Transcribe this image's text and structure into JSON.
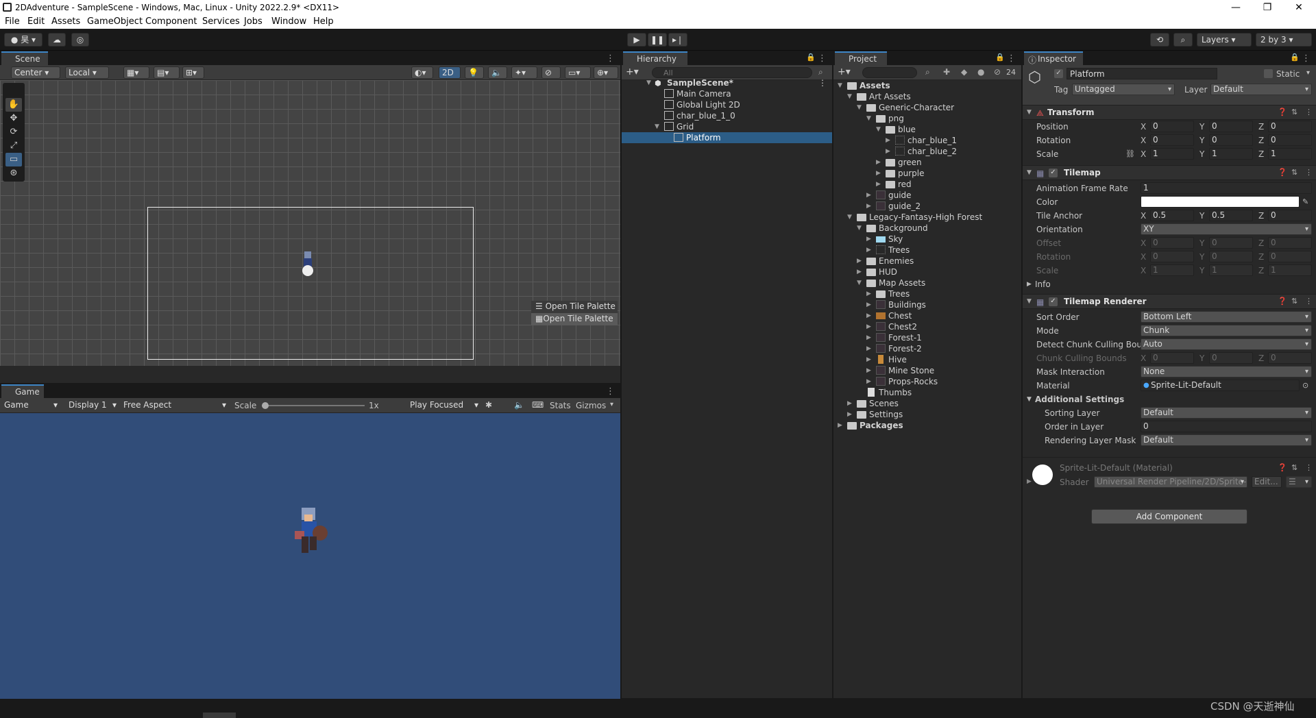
{
  "window": {
    "title": "2DAdventure - SampleScene - Windows, Mac, Linux - Unity 2022.2.9* <DX11>",
    "minimize": "—",
    "maximize": "❐",
    "close": "✕"
  },
  "menu": [
    "File",
    "Edit",
    "Assets",
    "GameObject",
    "Component",
    "Services",
    "Jobs",
    "Window",
    "Help"
  ],
  "toolbar": {
    "account": "昊",
    "layers_label": "Layers",
    "layout_label": "2 by 3"
  },
  "scene": {
    "tab": "Scene",
    "pivot": "Center",
    "space": "Local",
    "mode_2d": "2D",
    "open_tile_palette_1": "Open Tile Palette",
    "open_tile_palette_2": "Open Tile Palette"
  },
  "game": {
    "tab": "Game",
    "mode": "Game",
    "display": "Display 1",
    "aspect": "Free Aspect",
    "scale_label": "Scale",
    "scale_value": "1x",
    "play_focused": "Play Focused",
    "stats": "Stats",
    "gizmos": "Gizmos"
  },
  "hierarchy": {
    "tab": "Hierarchy",
    "search_placeholder": "All",
    "items": [
      {
        "label": "SampleScene*"
      },
      {
        "label": "Main Camera"
      },
      {
        "label": "Global Light 2D"
      },
      {
        "label": "char_blue_1_0"
      },
      {
        "label": "Grid"
      },
      {
        "label": "Platform"
      }
    ]
  },
  "project": {
    "tab": "Project",
    "hidden_count": "24",
    "items": [
      {
        "label": "Assets"
      },
      {
        "label": "Art Assets"
      },
      {
        "label": "Generic-Character"
      },
      {
        "label": "png"
      },
      {
        "label": "blue"
      },
      {
        "label": "char_blue_1"
      },
      {
        "label": "char_blue_2"
      },
      {
        "label": "green"
      },
      {
        "label": "purple"
      },
      {
        "label": "red"
      },
      {
        "label": "guide"
      },
      {
        "label": "guide_2"
      },
      {
        "label": "Legacy-Fantasy-High Forest"
      },
      {
        "label": "Background"
      },
      {
        "label": "Sky"
      },
      {
        "label": "Trees"
      },
      {
        "label": "Enemies"
      },
      {
        "label": "HUD"
      },
      {
        "label": "Map Assets"
      },
      {
        "label": "Trees"
      },
      {
        "label": "Buildings"
      },
      {
        "label": "Chest"
      },
      {
        "label": "Chest2"
      },
      {
        "label": "Forest-1"
      },
      {
        "label": "Forest-2"
      },
      {
        "label": "Hive"
      },
      {
        "label": "Mine Stone"
      },
      {
        "label": "Props-Rocks"
      },
      {
        "label": "Thumbs"
      },
      {
        "label": "Scenes"
      },
      {
        "label": "Settings"
      },
      {
        "label": "Packages"
      }
    ]
  },
  "inspector": {
    "tab": "Inspector",
    "object_name": "Platform",
    "static_label": "Static",
    "tag_label": "Tag",
    "tag_value": "Untagged",
    "layer_label": "Layer",
    "layer_value": "Default",
    "transform": {
      "title": "Transform",
      "position": {
        "label": "Position",
        "x": "0",
        "y": "0",
        "z": "0"
      },
      "rotation": {
        "label": "Rotation",
        "x": "0",
        "y": "0",
        "z": "0"
      },
      "scale": {
        "label": "Scale",
        "x": "1",
        "y": "1",
        "z": "1"
      }
    },
    "tilemap": {
      "title": "Tilemap",
      "frame_rate_label": "Animation Frame Rate",
      "frame_rate": "1",
      "color_label": "Color",
      "anchor_label": "Tile Anchor",
      "anchor_x": "0.5",
      "anchor_y": "0.5",
      "anchor_z": "0",
      "orientation_label": "Orientation",
      "orientation": "XY",
      "offset_label": "Offset",
      "offset": {
        "x": "0",
        "y": "0",
        "z": "0"
      },
      "rotation_label": "Rotation",
      "rotation": {
        "x": "0",
        "y": "0",
        "z": "0"
      },
      "scale_label": "Scale",
      "scale": {
        "x": "1",
        "y": "1",
        "z": "1"
      },
      "info_label": "Info"
    },
    "renderer": {
      "title": "Tilemap Renderer",
      "sort_order_label": "Sort Order",
      "sort_order": "Bottom Left",
      "mode_label": "Mode",
      "mode": "Chunk",
      "detect_label": "Detect Chunk Culling Boun",
      "detect": "Auto",
      "bounds_label": "Chunk Culling Bounds",
      "bounds": {
        "x": "0",
        "y": "0",
        "z": "0"
      },
      "mask_label": "Mask Interaction",
      "mask": "None",
      "material_label": "Material",
      "material": "Sprite-Lit-Default",
      "additional_label": "Additional Settings",
      "sorting_layer_label": "Sorting Layer",
      "sorting_layer": "Default",
      "order_label": "Order in Layer",
      "order": "0",
      "render_mask_label": "Rendering Layer Mask",
      "render_mask": "Default"
    },
    "material_block": {
      "title": "Sprite-Lit-Default (Material)",
      "shader_label": "Shader",
      "shader": "Universal Render Pipeline/2D/Sprite-",
      "edit": "Edit..."
    },
    "add_component": "Add Component"
  },
  "watermark": "CSDN @天逝神仙",
  "colors": {
    "accent": "#3d85c6",
    "selection": "#2c5d87",
    "game_bg": "#314d79",
    "scene_bg": "#444444"
  }
}
